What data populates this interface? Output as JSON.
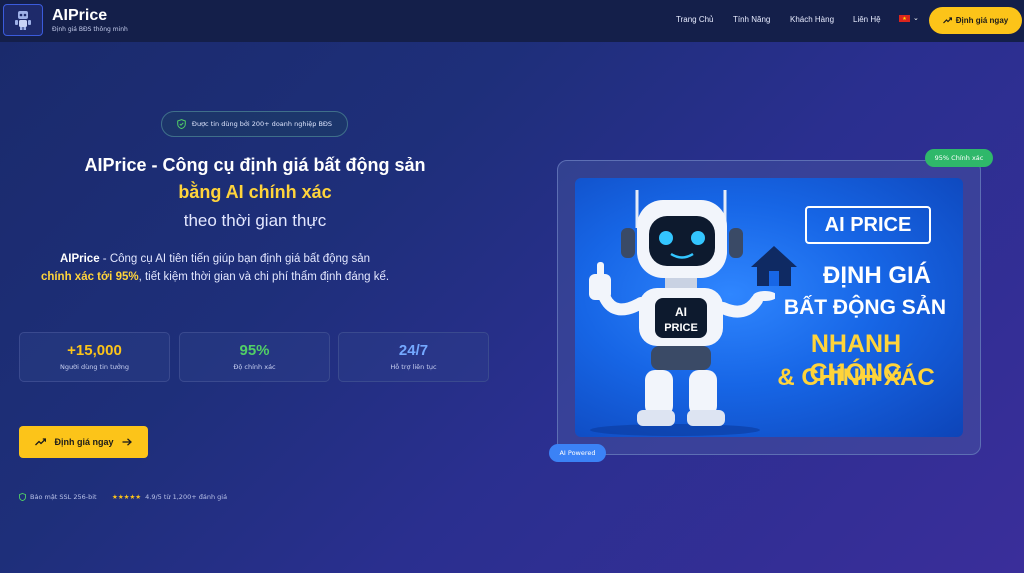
{
  "header": {
    "brand": "AIPrice",
    "tagline": "Định giá BĐS thông minh",
    "nav": [
      "Trang Chủ",
      "Tính Năng",
      "Khách Hàng",
      "Liên Hệ"
    ],
    "cta": "Định giá ngay"
  },
  "hero": {
    "trust": "Được tin dùng bởi 200+ doanh nghiệp BĐS",
    "title_line1": "AIPrice - Công cụ định giá bất động sản",
    "title_line2": "bằng AI chính xác",
    "title_line3": "theo thời gian thực",
    "desc_brand": "AIPrice",
    "desc_part1": " - Công cụ AI tiên tiến giúp bạn định giá bất động sản",
    "desc_highlight": "chính xác tới 95%",
    "desc_part2": ", tiết kiệm thời gian và chi phí thẩm định đáng kể.",
    "stats": [
      {
        "value": "+15,000",
        "label": "Người dùng tin tưởng",
        "color": "#fcc419"
      },
      {
        "value": "95%",
        "label": "Độ chính xác",
        "color": "#51cf66"
      },
      {
        "value": "24/7",
        "label": "Hỗ trợ liên tục",
        "color": "#74a8ff"
      }
    ],
    "cta": "Định giá ngay",
    "security": "Bảo mật SSL 256-bit",
    "stars": "★★★★★",
    "rating": "4.9/5 từ 1,200+ đánh giá"
  },
  "visual": {
    "badge_accuracy": "95% Chính xác",
    "badge_ai": "AI Powered",
    "poster_title": "AI PRICE",
    "poster_lines": [
      "ĐỊNH GIÁ",
      "BẤT ĐỘNG SẢN",
      "NHANH CHÓNG",
      "& CHÍNH XÁC"
    ],
    "robot_chest_line1": "AI",
    "robot_chest_line2": "PRICE"
  },
  "colors": {
    "accent": "#fcc419",
    "green": "#2fb86a",
    "blue": "#3b82f6"
  }
}
